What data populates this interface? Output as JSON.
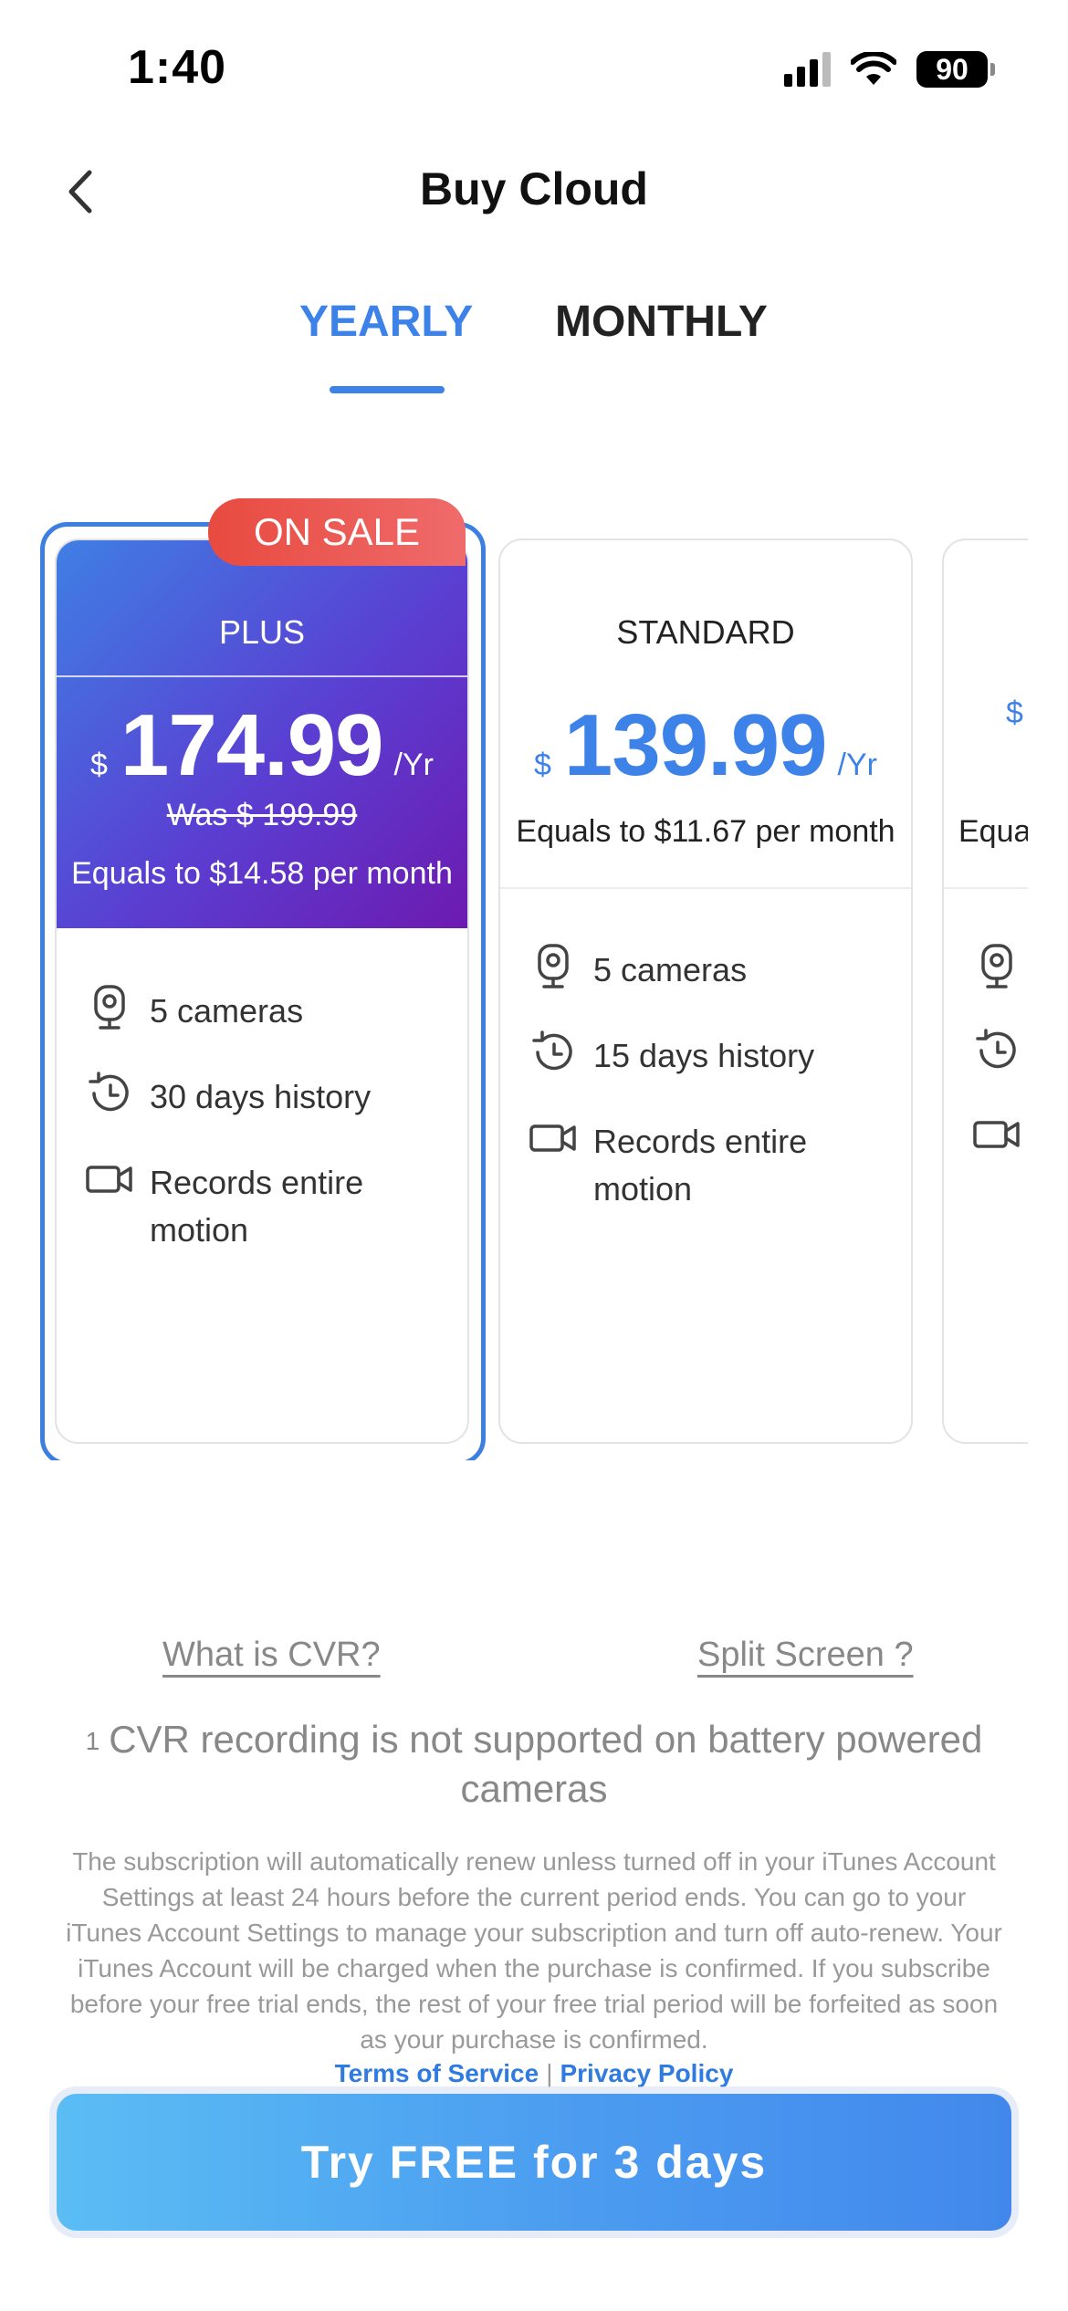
{
  "status_bar": {
    "time": "1:40",
    "battery": "90"
  },
  "nav": {
    "title": "Buy Cloud"
  },
  "tabs": [
    {
      "label": "YEARLY",
      "active": true
    },
    {
      "label": "MONTHLY",
      "active": false
    }
  ],
  "colors": {
    "accent": "#3d82e8",
    "sale": "#e84a3f",
    "plus_gradient_start": "#3f7fe4",
    "plus_gradient_end": "#6d1ab0"
  },
  "plans": [
    {
      "badge": "ON SALE",
      "name": "PLUS",
      "currency": "$",
      "price": "174.99",
      "unit": "/Yr",
      "was": "Was $ 199.99",
      "per_month": "Equals to $14.58 per month",
      "selected": true,
      "features": [
        {
          "icon": "camera-icon",
          "text": "5 cameras"
        },
        {
          "icon": "history-icon",
          "text": "30 days history"
        },
        {
          "icon": "video-icon",
          "text": "Records entire motion"
        }
      ]
    },
    {
      "name": "STANDARD",
      "currency": "$",
      "price": "139.99",
      "unit": "/Yr",
      "per_month": "Equals to $11.67 per month",
      "selected": false,
      "features": [
        {
          "icon": "camera-icon",
          "text": "5 cameras"
        },
        {
          "icon": "history-icon",
          "text": "15 days history"
        },
        {
          "icon": "video-icon",
          "text": "Records entire motion"
        }
      ]
    },
    {
      "currency": "$",
      "per_month": "Equa",
      "selected": false
    }
  ],
  "links": {
    "cvr": "What is CVR?",
    "split_screen": "Split Screen ?"
  },
  "cvr_note": {
    "marker": "1",
    "text": "CVR recording is not supported on battery powered cameras"
  },
  "terms": {
    "text": "The subscription will automatically renew unless turned off in your iTunes Account Settings at least 24 hours before the current period ends. You can go to your iTunes Account Settings to manage your subscription and turn off auto-renew. Your iTunes Account will be charged when the purchase is confirmed. If you subscribe before your free trial ends, the rest of your free trial period will be forfeited as soon as your purchase is confirmed.",
    "terms_of_service": "Terms of Service",
    "separator": "|",
    "privacy_policy": "Privacy Policy"
  },
  "cta": {
    "label": "Try FREE for 3 days"
  }
}
